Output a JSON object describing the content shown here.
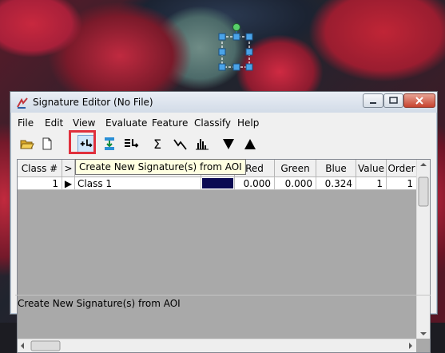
{
  "window": {
    "title": "Signature Editor (No File)"
  },
  "menu": [
    "File",
    "Edit",
    "View",
    "Evaluate",
    "Feature",
    "Classify",
    "Help"
  ],
  "toolbar": {
    "icons": [
      "open-folder-icon",
      "new-document-icon",
      "create-signature-from-aoi-icon",
      "replace-signature-icon",
      "merge-signatures-icon",
      "statistics-sigma-icon",
      "mean-plot-icon",
      "histogram-icon",
      "move-down-icon",
      "move-up-icon"
    ],
    "highlight_color": "#e0303d"
  },
  "tooltip": "Create New Signature(s) from AOI",
  "grid": {
    "headers": [
      "Class #",
      ">",
      "",
      "",
      "Red",
      "Green",
      "Blue",
      "Value",
      "Order"
    ],
    "rows": [
      {
        "class_num": "1",
        "marker": "▶",
        "name": "Class 1",
        "color": "#0b0a52",
        "red": "0.000",
        "green": "0.000",
        "blue": "0.324",
        "value": "1",
        "order": "1"
      }
    ]
  },
  "status": "Create New Signature(s) from AOI"
}
